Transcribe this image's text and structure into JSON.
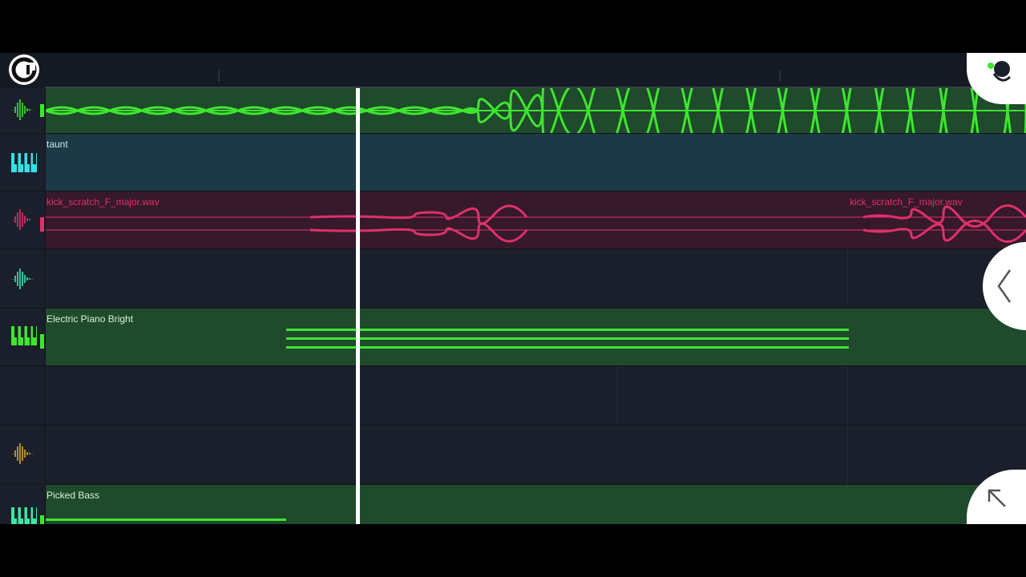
{
  "colors": {
    "green": "#3ee62e",
    "green_dark": "#1f4a2c",
    "teal": "#1b3a45",
    "pink": "#e0306c",
    "pink_dark": "#36192a",
    "cyan_icon": "#36e0e8",
    "yellow_icon": "#d7a830",
    "background": "#1a1f2b"
  },
  "tracks": [
    {
      "id": "track-1",
      "type": "audio",
      "icon": "waveform-icon",
      "clip_label": "",
      "color": "green"
    },
    {
      "id": "track-2",
      "type": "instrument",
      "icon": "piano-keys-icon",
      "clip_label": "taunt",
      "color": "teal"
    },
    {
      "id": "track-3",
      "type": "audio",
      "icon": "waveform-icon",
      "clip_label": "kick_scratch_F_major.wav",
      "clip_label_2": "kick_scratch_F_major.wav",
      "color": "pink"
    },
    {
      "id": "track-4",
      "type": "audio",
      "icon": "waveform-icon",
      "clip_label": "",
      "color": "none"
    },
    {
      "id": "track-5",
      "type": "instrument",
      "icon": "piano-keys-icon",
      "clip_label": "Electric Piano Bright",
      "color": "green"
    },
    {
      "id": "track-6",
      "type": "empty",
      "icon": "",
      "clip_label": "",
      "color": "none"
    },
    {
      "id": "track-7",
      "type": "audio",
      "icon": "waveform-icon",
      "clip_label": "",
      "color": "none"
    },
    {
      "id": "track-8",
      "type": "instrument",
      "icon": "piano-keys-icon",
      "clip_label": "Picked Bass",
      "color": "green"
    }
  ],
  "overlay": {
    "collapse_icon": "chevron-left-icon",
    "expand_icon": "arrow-up-left-icon",
    "app_logo_icon": "app-logo-icon",
    "avatar_icon": "avatar-icon"
  }
}
